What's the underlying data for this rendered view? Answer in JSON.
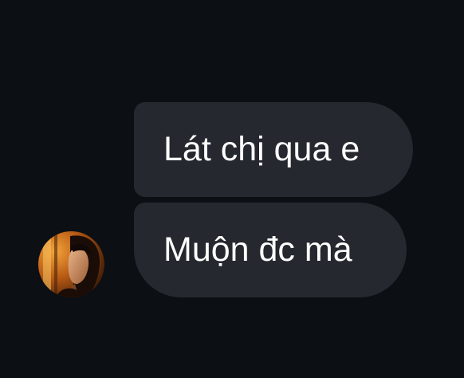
{
  "messages": [
    {
      "text": "Lát chị qua e"
    },
    {
      "text": "Muộn đc mà"
    }
  ],
  "colors": {
    "background": "#0c0f14",
    "bubble": "#25282e",
    "text": "#ffffff"
  },
  "avatar": {
    "icon": "user-profile-photo"
  }
}
